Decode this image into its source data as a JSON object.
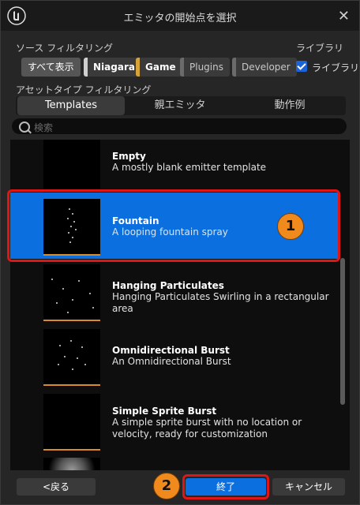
{
  "window": {
    "title": "エミッタの開始点を選択"
  },
  "source_filter": {
    "label": "ソース フィルタリング",
    "chips": [
      {
        "label": "すべて表示",
        "color": "#555555"
      },
      {
        "label": "Niagara",
        "color": "#cfcfcf"
      },
      {
        "label": "Game",
        "color": "#d6a23a"
      },
      {
        "label": "Plugins",
        "color": "#6b6b6b"
      },
      {
        "label": "Developer",
        "color": "#6b6b6b"
      }
    ]
  },
  "library": {
    "label": "ライブラリ",
    "checkbox_label": "ライブラリの"
  },
  "asset_filter": {
    "label": "アセットタイプ フィルタリング"
  },
  "tabs": [
    "Templates",
    "親エミッタ",
    "動作例"
  ],
  "search": {
    "placeholder": "検索"
  },
  "templates": [
    {
      "name": "Empty",
      "desc": "A mostly blank emitter template"
    },
    {
      "name": "Fountain",
      "desc": "A looping fountain spray"
    },
    {
      "name": "Hanging Particulates",
      "desc": "Hanging Particulates Swirling in a rectangular area"
    },
    {
      "name": "Omnidirectional Burst",
      "desc": "An Omnidirectional Burst"
    },
    {
      "name": "Simple Sprite Burst",
      "desc": "A simple sprite burst with no location or velocity, ready for customization"
    }
  ],
  "markers": [
    "1",
    "2"
  ],
  "buttons": {
    "back": "<戻る",
    "finish": "終了",
    "cancel": "キャンセル"
  },
  "colors": {
    "accent": "#0c6fe0",
    "highlight": "#e01515",
    "marker": "#f08a1c",
    "thumb_line": "#d98b2b"
  }
}
